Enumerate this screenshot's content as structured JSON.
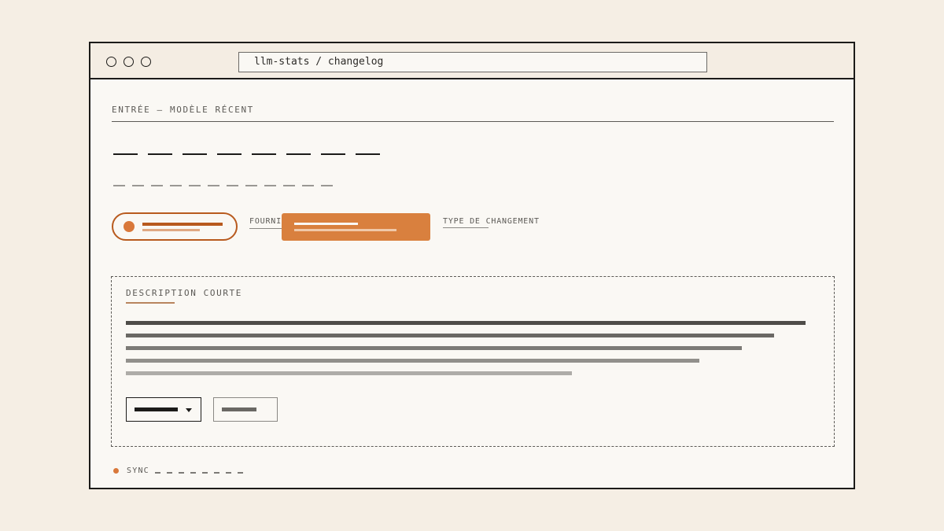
{
  "window": {
    "controls": [
      "window-dot-1",
      "window-dot-2",
      "window-dot-3"
    ],
    "url": "llm-stats / changelog"
  },
  "entry": {
    "section_title": "ENTRÉE — MODÈLE RÉCENT"
  },
  "fields": {
    "provider_label": "FOURNIS",
    "change_type_label": "TYPE DE CHANGEMENT"
  },
  "description": {
    "title": "DESCRIPTION COURTE"
  },
  "status": {
    "sync_label": "SYNC"
  },
  "colors": {
    "accent": "#d9803e",
    "accent_dark": "#b85a1e",
    "ink": "#1c1b19",
    "panel": "#faf8f4",
    "background": "#f5eee4"
  }
}
